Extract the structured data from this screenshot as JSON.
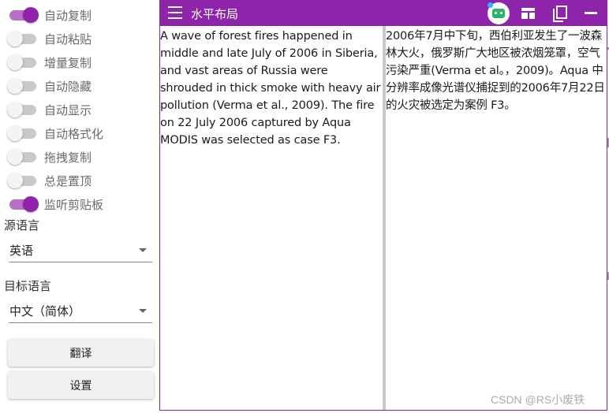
{
  "sidebar": {
    "toggles": [
      {
        "label": "自动复制",
        "on": true
      },
      {
        "label": "自动粘贴",
        "on": false
      },
      {
        "label": "增量复制",
        "on": false
      },
      {
        "label": "自动隐藏",
        "on": false
      },
      {
        "label": "自动显示",
        "on": false
      },
      {
        "label": "自动格式化",
        "on": false
      },
      {
        "label": "拖拽复制",
        "on": false
      },
      {
        "label": "总是置顶",
        "on": false
      },
      {
        "label": "监听剪贴板",
        "on": true
      }
    ],
    "source_language": {
      "label": "源语言",
      "value": "英语"
    },
    "target_language": {
      "label": "目标语言",
      "value": "中文（简体）"
    },
    "translate_button": "翻译",
    "settings_button": "设置"
  },
  "appbar": {
    "title": "水平布局",
    "icons": [
      "menu-icon",
      "bot-icon",
      "layout-icon",
      "copy-icon",
      "minimize-icon"
    ]
  },
  "source_text": "A wave of forest fires happened in middle and late July of 2006 in Siberia, and vast areas of Russia were shrouded in thick smoke with heavy air pollution (Verma et al., 2009). The fire on 22 July 2006 captured by Aqua MODIS was selected as case F3.",
  "target_text": "2006年7月中下旬，西伯利亚发生了一波森林大火，俄罗斯广大地区被浓烟笼罩，空气污染严重(Verma et al。，2009)。Aqua 中分辨率成像光谱仪捕捉到的2006年7月22日的火灾被选定为案例 F3。",
  "watermark": "CSDN @RS小废铁",
  "colors": {
    "accent": "#8e24aa",
    "switch_track_on": "#b76ec8",
    "switch_off": "#c9c9c9"
  }
}
